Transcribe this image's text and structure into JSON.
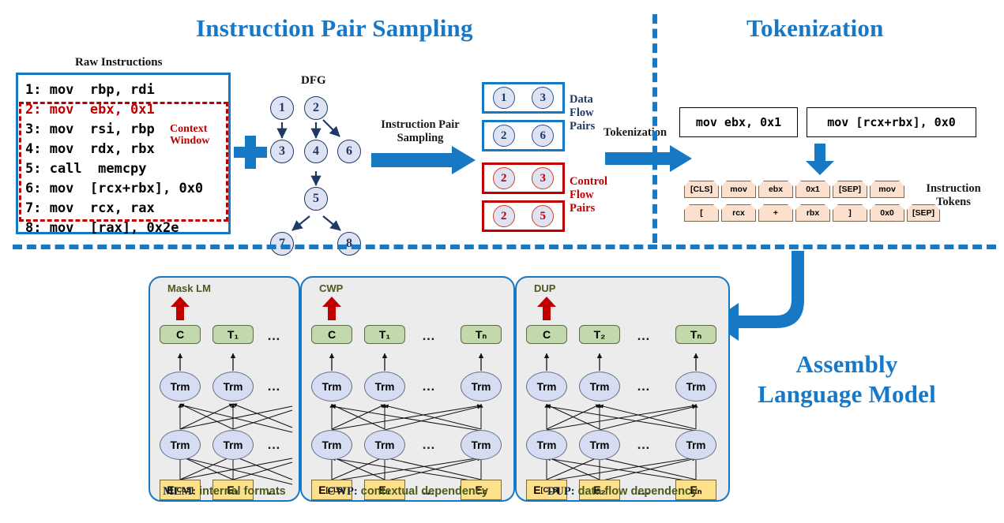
{
  "sections": {
    "left_title": "Instruction Pair Sampling",
    "right_title": "Tokenization",
    "bottom_title_line1": "Assembly",
    "bottom_title_line2": "Language Model"
  },
  "colors": {
    "brand_blue": "#1778c4",
    "accent_red": "#c00000",
    "token_fill": "#fbe0cd",
    "trm_fill": "#d6dcf2",
    "c_fill": "#c3d9ac",
    "e_fill": "#ffe08a",
    "panel_fill": "#ececec",
    "olive": "#4a5a1e"
  },
  "raw_instructions": {
    "label": "Raw Instructions",
    "lines": [
      {
        "text": "1: mov  rbp, rdi",
        "highlight": false
      },
      {
        "text": "2: mov  ebx, 0x1",
        "highlight": true
      },
      {
        "text": "3: mov  rsi, rbp",
        "highlight": false
      },
      {
        "text": "4: mov  rdx, rbx",
        "highlight": false
      },
      {
        "text": "5: call  memcpy",
        "highlight": false
      },
      {
        "text": "6: mov  [rcx+rbx], 0x0",
        "highlight": false
      },
      {
        "text": "7: mov  rcx, rax",
        "highlight": false
      },
      {
        "text": "8: mov  [rax], 0x2e",
        "highlight": false
      }
    ],
    "context_window_line1": "Context",
    "context_window_line2": "Window"
  },
  "dfg": {
    "label": "DFG",
    "nodes": [
      "1",
      "2",
      "3",
      "4",
      "6",
      "5",
      "7",
      "8"
    ],
    "edges": [
      [
        "1",
        "3"
      ],
      [
        "2",
        "4"
      ],
      [
        "2",
        "6"
      ],
      [
        "4",
        "5"
      ],
      [
        "5",
        "7"
      ],
      [
        "5",
        "8"
      ]
    ]
  },
  "arrows": {
    "sampling_line1": "Instruction Pair",
    "sampling_line2": "Sampling",
    "tokenization": "Tokenization"
  },
  "pairs": {
    "data_flow": {
      "label_lines": [
        "Data",
        "Flow",
        "Pairs"
      ],
      "items": [
        [
          "1",
          "3"
        ],
        [
          "2",
          "6"
        ]
      ]
    },
    "control_flow": {
      "label_lines": [
        "Control",
        "Flow",
        "Pairs"
      ],
      "items": [
        [
          "2",
          "3"
        ],
        [
          "2",
          "5"
        ]
      ]
    }
  },
  "tokenization": {
    "instruction_boxes": [
      "mov ebx, 0x1",
      "mov [rcx+rbx], 0x0"
    ],
    "tokens_row1": [
      "[CLS]",
      "mov",
      "ebx",
      "0x1",
      "[SEP]",
      "mov"
    ],
    "tokens_row2": [
      "[",
      "rcx",
      "+",
      "rbx",
      "]",
      "0x0",
      "[SEP]"
    ],
    "tokens_label_line1": "Instruction",
    "tokens_label_line2": "Tokens"
  },
  "model_panels": [
    {
      "task": "Mask LM",
      "caption_prefix": "MLM:",
      "caption_rest": " internal formats",
      "outputs": [
        "C",
        "T₁",
        "…"
      ],
      "embeddings": [
        "E[CLS]",
        "E₁",
        "…"
      ],
      "trm_label": "Trm",
      "columns": 2,
      "has_tail": false
    },
    {
      "task": "CWP",
      "caption_prefix": "CWP:",
      "caption_rest": " contextual dependency",
      "outputs": [
        "C",
        "T₁",
        "…",
        "Tₙ"
      ],
      "embeddings": [
        "E[CLS]",
        "E₁",
        "…",
        "Eₙ"
      ],
      "trm_label": "Trm",
      "columns": 3,
      "has_tail": true
    },
    {
      "task": "DUP",
      "caption_prefix": "DUP:",
      "caption_rest": " data flow dependency",
      "outputs": [
        "C",
        "T₂",
        "…",
        "Tₙ"
      ],
      "embeddings": [
        "E[CLS]",
        "E₂",
        "…",
        "Eₙ"
      ],
      "trm_label": "Trm",
      "columns": 3,
      "has_tail": true
    }
  ]
}
